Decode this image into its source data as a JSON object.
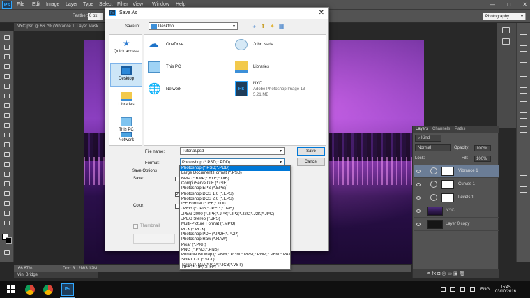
{
  "photoshop": {
    "logo": "Ps",
    "menu": [
      "File",
      "Edit",
      "Image",
      "Layer",
      "Type",
      "Select",
      "Filter",
      "View",
      "Window",
      "Help"
    ],
    "window_controls": [
      "—",
      "□",
      "✕"
    ],
    "options_bar": {
      "feather_label": "Feather:",
      "feather_value": "0 px",
      "workspace": "Photography"
    },
    "doc_tab": "NYC.psd @ 66.7% (Vibrance 1, Layer Mask",
    "status": {
      "zoom": "66.67%",
      "doc": "Doc: 3.12M/3.12M"
    },
    "mini_bridge": "Mini Bridge"
  },
  "layers_panel": {
    "tabs": [
      "Layers",
      "Channels",
      "Paths"
    ],
    "kind_label": "Kind",
    "blend_mode": "Normal",
    "opacity_label": "Opacity:",
    "opacity_value": "100%",
    "lock_label": "Lock:",
    "fill_label": "Fill:",
    "fill_value": "100%",
    "layers": [
      {
        "name": "Vibrance 1",
        "selected": true
      },
      {
        "name": "Curves 1",
        "selected": false
      },
      {
        "name": "Levels 1",
        "selected": false
      },
      {
        "name": "NYC",
        "selected": false
      },
      {
        "name": "Layer 0 copy",
        "selected": false
      }
    ],
    "footer_icons": "⚭ fx ◘ ◎ ▭ ▣ 🗑"
  },
  "save_dialog": {
    "icon": "Ps",
    "title": "Save As",
    "close": "✕",
    "save_in_label": "Save in:",
    "save_in_value": "Desktop",
    "nav_icons": [
      "back-icon",
      "up-folder-icon",
      "new-folder-icon",
      "view-menu-icon"
    ],
    "places": [
      {
        "label": "Quick access",
        "selected": false
      },
      {
        "label": "Desktop",
        "selected": true
      },
      {
        "label": "Libraries",
        "selected": false
      },
      {
        "label": "This PC",
        "selected": false
      },
      {
        "label": "Network",
        "selected": false
      }
    ],
    "files": [
      {
        "name": "OneDrive",
        "type": "cloud"
      },
      {
        "name": "John Nada",
        "type": "user"
      },
      {
        "name": "This PC",
        "type": "pc"
      },
      {
        "name": "Libraries",
        "type": "folder"
      },
      {
        "name": "Network",
        "type": "network"
      },
      {
        "name": "NYC",
        "type": "psd",
        "line2": "Adobe Photoshop Image 13",
        "line3": "5.21 MB"
      }
    ],
    "file_name_label": "File name:",
    "file_name_value": "Tutorial.psd",
    "format_label": "Format:",
    "format_value": "Photoshop (*.PSD;*.PDD)",
    "save_button": "Save",
    "cancel_button": "Cancel",
    "save_options_label": "Save Options",
    "save_label": "Save:",
    "color_label": "Color:",
    "thumbnail_label": "Thumbnail",
    "format_options": [
      "Photoshop (*.PSD;*.PDD)",
      "Large Document Format (*.PSB)",
      "BMP (*.BMP;*.RLE;*.DIB)",
      "CompuServe GIF (*.GIF)",
      "Photoshop EPS (*.EPS)",
      "Photoshop DCS 1.0 (*.EPS)",
      "Photoshop DCS 2.0 (*.EPS)",
      "IFF Format (*.IFF;*.TDI)",
      "JPEG (*.JPG;*.JPEG;*.JPE)",
      "JPEG 2000 (*.JPF;*.JPX;*.JP2;*.J2C;*.J2K;*.JPC)",
      "JPEG Stereo (*.JPS)",
      "Multi-Picture Format (*.MPO)",
      "PCX (*.PCX)",
      "Photoshop PDF (*.PDF;*.PDP)",
      "Photoshop Raw (*.RAW)",
      "Pixar (*.PXR)",
      "PNG (*.PNG;*.PNS)",
      "Portable Bit Map (*.PBM;*.PGM;*.PPM;*.PNM;*.PFM;*.PAM)",
      "Scitex CT (*.SCT)",
      "Targa (*.TGA;*.VDA;*.ICB;*.VST)",
      "TIFF (*.TIF;*.TIFF)"
    ]
  },
  "taskbar": {
    "ps_label": "Ps",
    "language": "ENG",
    "time": "15:45",
    "date": "03/10/2016"
  },
  "colors": {
    "ps_panel": "#535353",
    "selection_blue": "#0078d7",
    "canvas_purple": "#8b3fc0"
  }
}
